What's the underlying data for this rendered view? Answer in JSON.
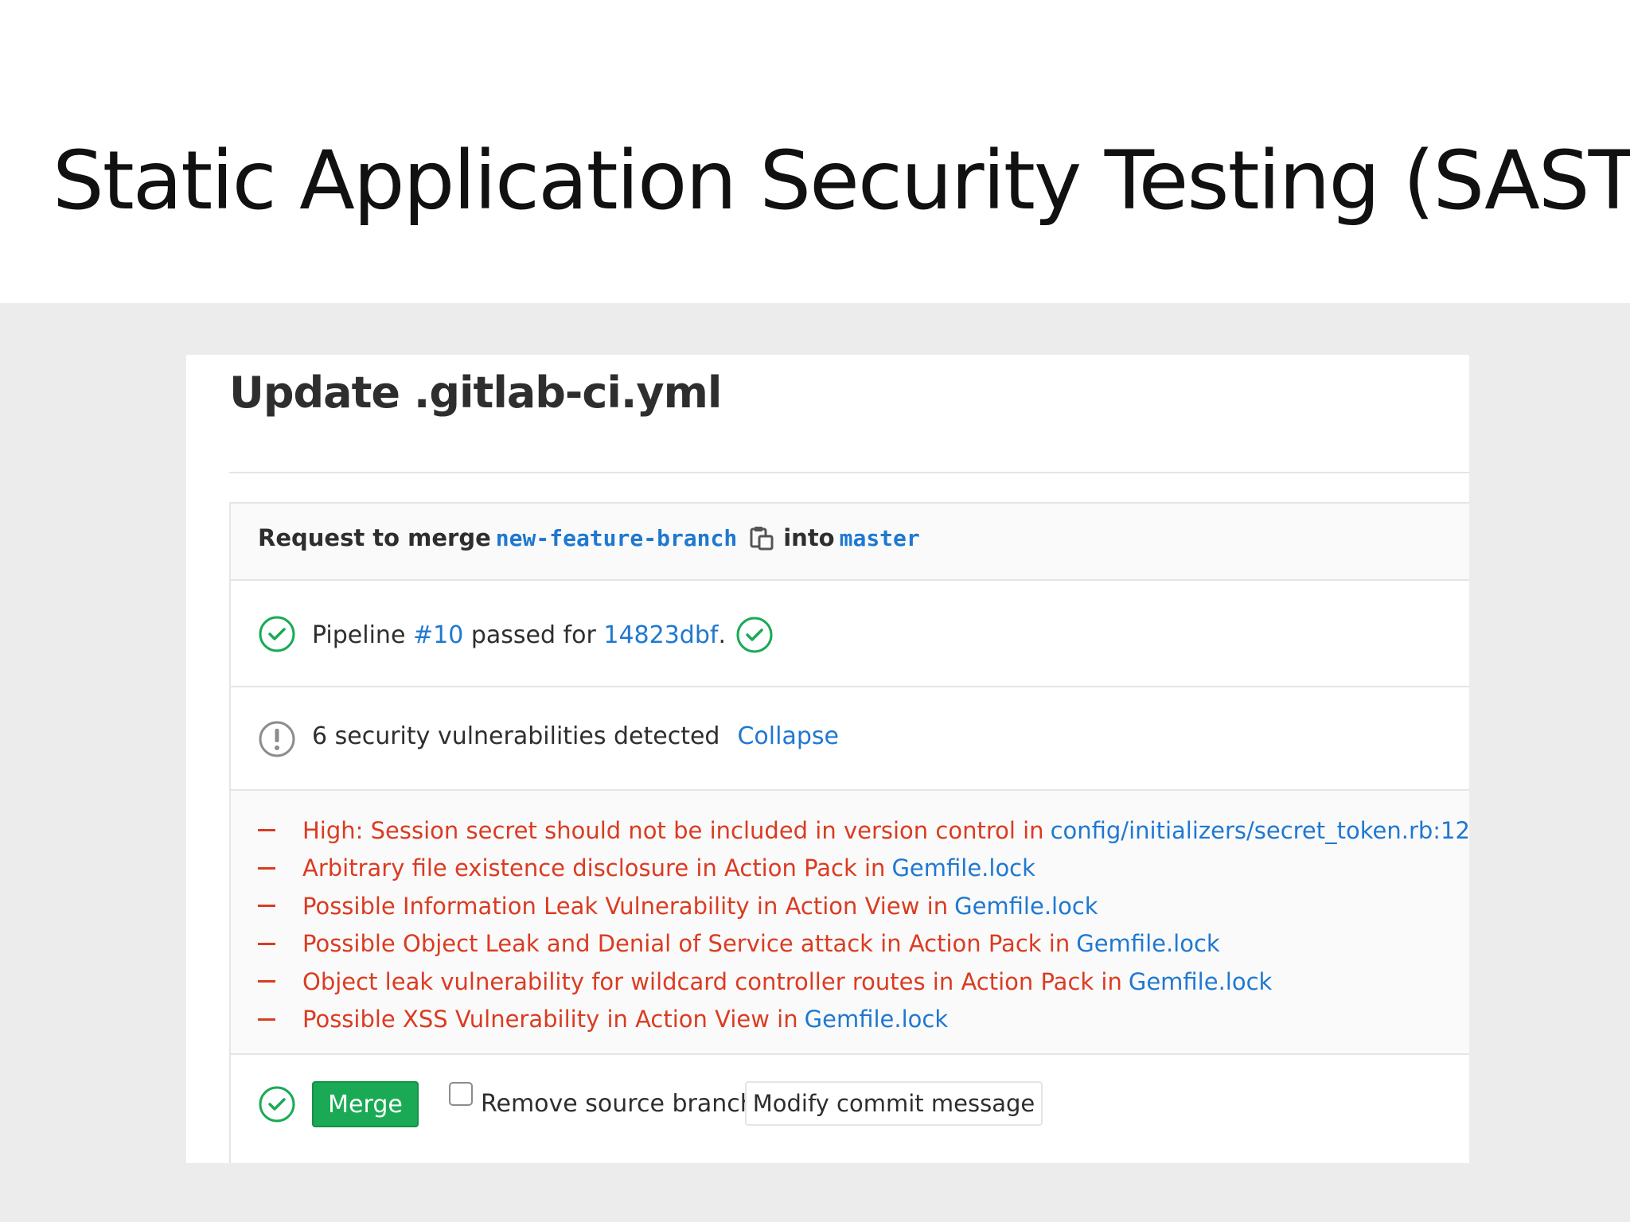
{
  "slide": {
    "title": "Static Application Security Testing (SAST)"
  },
  "merge_request": {
    "title": "Update .gitlab-ci.yml",
    "request": {
      "prefix": "Request to merge",
      "source_branch": "new-feature-branch",
      "copy_icon": "clipboard-icon",
      "connector": "into",
      "target_branch": "master"
    },
    "pipeline": {
      "status_icon": "check-circle-icon",
      "prefix": "Pipeline",
      "number": "#10",
      "middle": "passed for",
      "commit": "14823dbf",
      "suffix": "."
    },
    "security": {
      "status_icon": "warning-circle-icon",
      "summary": "6 security vulnerabilities detected",
      "collapse_label": "Collapse"
    },
    "vulnerabilities": [
      {
        "text": "High: Session secret should not be included in version control in",
        "file": "config/initializers/secret_token.rb:12"
      },
      {
        "text": "Arbitrary file existence disclosure in Action Pack in",
        "file": "Gemfile.lock"
      },
      {
        "text": "Possible Information Leak Vulnerability in Action View in",
        "file": "Gemfile.lock"
      },
      {
        "text": "Possible Object Leak and Denial of Service attack in Action Pack in",
        "file": "Gemfile.lock"
      },
      {
        "text": "Object leak vulnerability for wildcard controller routes in Action Pack in",
        "file": "Gemfile.lock"
      },
      {
        "text": "Possible XSS Vulnerability in Action View in",
        "file": "Gemfile.lock"
      }
    ],
    "merge_actions": {
      "status_icon": "check-circle-icon",
      "merge_label": "Merge",
      "remove_source_branch_label": "Remove source branch",
      "remove_source_branch_checked": false,
      "modify_commit_label": "Modify commit message"
    }
  },
  "colors": {
    "success": "#1aaa55",
    "danger": "#db3b21",
    "link": "#1f78d1",
    "text": "#2e2e2e",
    "border": "#e5e5e5",
    "slide_background": "#ececec"
  }
}
